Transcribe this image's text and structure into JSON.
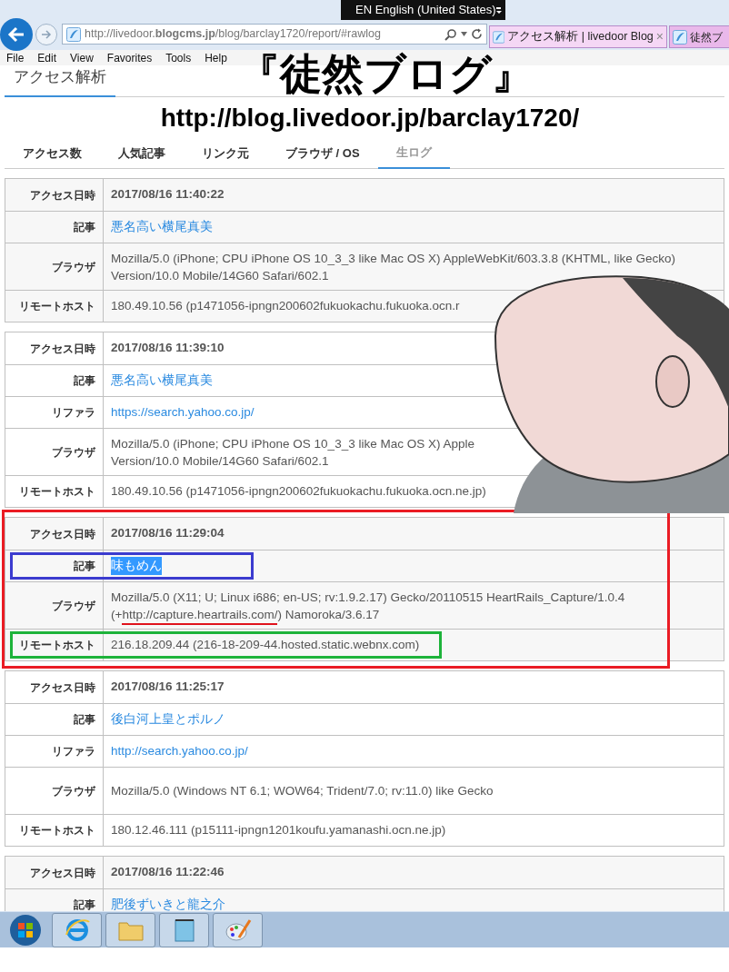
{
  "language_bar": {
    "label": "EN English (United States)"
  },
  "address_bar": {
    "url": "http://livedoor.**blogcms.jp**/blog/barclay1720/report/#rawlog"
  },
  "browser_tabs": [
    {
      "title": "アクセス解析 | livedoor Blog",
      "selected": true,
      "close": "×"
    },
    {
      "title": "徒然ブ",
      "selected": false
    }
  ],
  "menu": [
    "File",
    "Edit",
    "View",
    "Favorites",
    "Tools",
    "Help"
  ],
  "overlay": {
    "title": "『徒然ブログ』",
    "url": "http://blog.livedoor.jp/barclay1720/"
  },
  "page": {
    "heading": "アクセス解析",
    "tabs": [
      {
        "label": "アクセス数",
        "selected": false
      },
      {
        "label": "人気記事",
        "selected": false
      },
      {
        "label": "リンク元",
        "selected": false
      },
      {
        "label": "ブラウザ / OS",
        "selected": false
      },
      {
        "label": "生ログ",
        "selected": true
      }
    ],
    "entries": [
      {
        "framed": false,
        "rows": [
          {
            "kind": "datetime",
            "label": "アクセス日時",
            "value": "2017/08/16 11:40:22"
          },
          {
            "kind": "link",
            "label": "記事",
            "value": "悪名高い横尾真美",
            "selected": false
          },
          {
            "kind": "text",
            "label": "ブラウザ",
            "segments": [
              {
                "text": "Mozilla/5.0 (iPhone; CPU iPhone OS 10_3_3 like Mac OS X) AppleWebKit/603.3.8 (KHTML, like Gecko)\nVersion/10.0 Mobile/14G60 Safari/602.1",
                "underlined": false
              }
            ]
          },
          {
            "kind": "text",
            "label": "リモートホスト",
            "value": "180.49.10.56 (p1471056-ipngn200602fukuokachu.fukuoka.ocn.r"
          }
        ]
      },
      {
        "framed": false,
        "rows": [
          {
            "kind": "datetime",
            "label": "アクセス日時",
            "value": "2017/08/16 11:39:10"
          },
          {
            "kind": "link",
            "label": "記事",
            "value": "悪名高い横尾真美",
            "selected": false
          },
          {
            "kind": "link",
            "label": "リファラ",
            "value": "https://search.yahoo.co.jp/",
            "selected": false
          },
          {
            "kind": "text",
            "label": "ブラウザ",
            "segments": [
              {
                "text": "Mozilla/5.0 (iPhone; CPU iPhone OS 10_3_3 like Mac OS X) Apple\nVersion/10.0 Mobile/14G60 Safari/602.1",
                "underlined": false
              }
            ]
          },
          {
            "kind": "text",
            "label": "リモートホスト",
            "value": "180.49.10.56 (p1471056-ipngn200602fukuokachu.fukuoka.ocn.ne.jp)"
          }
        ]
      },
      {
        "framed": true,
        "rows": [
          {
            "kind": "datetime",
            "label": "アクセス日時",
            "value": "2017/08/16 11:29:04"
          },
          {
            "kind": "link",
            "label": "記事",
            "value": "味もめん",
            "selected": true,
            "color": "#3b3bcf"
          },
          {
            "kind": "text",
            "label": "ブラウザ",
            "segments": [
              {
                "text": "Mozilla/5.0 (X11; U; Linux i686; en-US; rv:1.9.2.17) Gecko/20110515 HeartRails_Capture/1.0.4\n(+",
                "underlined": false
              },
              {
                "text": "http://capture.heartrails.com/",
                "underlined": true
              },
              {
                "text": ") Namoroka/3.6.17",
                "underlined": false
              }
            ]
          },
          {
            "kind": "text",
            "label": "リモートホスト",
            "value": "216.18.209.44 (216-18-209-44.hosted.static.webnx.com)",
            "color": "#1db33a"
          }
        ]
      },
      {
        "framed": false,
        "rows": [
          {
            "kind": "datetime",
            "label": "アクセス日時",
            "value": "2017/08/16 11:25:17"
          },
          {
            "kind": "link",
            "label": "記事",
            "value": "後白河上皇とポルノ",
            "selected": false
          },
          {
            "kind": "link",
            "label": "リファラ",
            "value": "http://search.yahoo.co.jp/",
            "selected": false
          },
          {
            "kind": "text",
            "label": "ブラウザ",
            "segments": [
              {
                "text": "Mozilla/5.0 (Windows NT 6.1; WOW64; Trident/7.0; rv:11.0) like Gecko",
                "underlined": false
              }
            ]
          },
          {
            "kind": "text",
            "label": "リモートホスト",
            "value": "180.12.46.111 (p15111-ipngn1201koufu.yamanashi.ocn.ne.jp)"
          }
        ]
      },
      {
        "framed": false,
        "rows": [
          {
            "kind": "datetime",
            "label": "アクセス日時",
            "value": "2017/08/16 11:22:46"
          },
          {
            "kind": "link",
            "label": "記事",
            "value": "肥後ずいきと龍之介",
            "selected": false
          },
          {
            "kind": "blank"
          }
        ]
      }
    ]
  }
}
